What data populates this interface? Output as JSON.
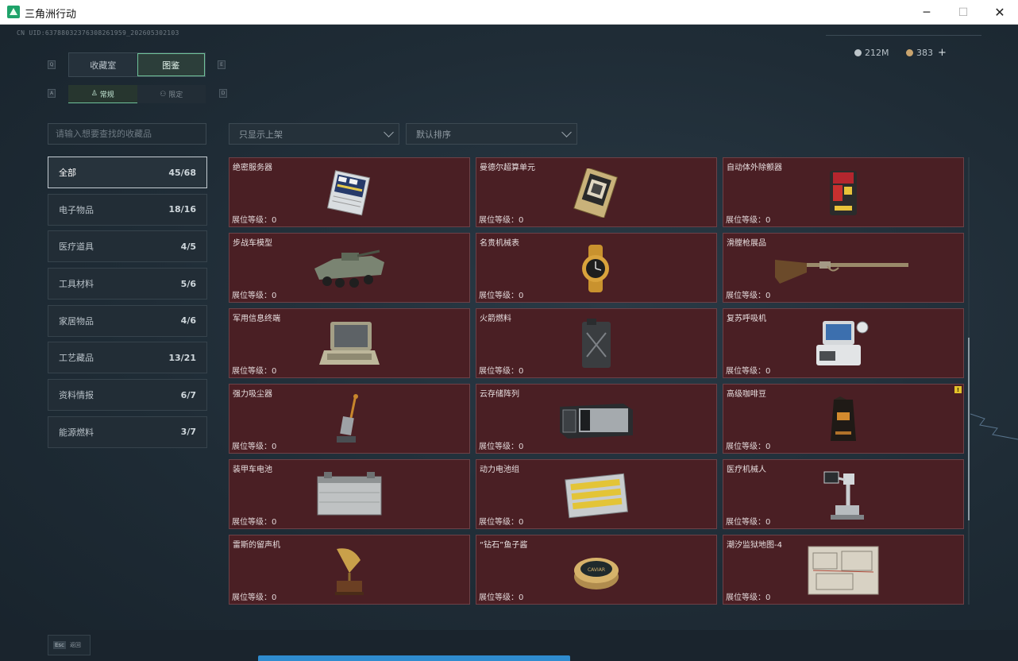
{
  "window": {
    "title": "三角洲行动",
    "min_glyph": "─",
    "max_glyph": "☐",
    "close_glyph": "✕"
  },
  "header": {
    "uid": "CN UID:6378803237630826195​9_202605302103",
    "currency_1": "212M",
    "currency_2": "383",
    "add_glyph": "+"
  },
  "hints": {
    "q": "Q",
    "e": "E",
    "a": "A",
    "d": "D"
  },
  "tabs": [
    {
      "label": "收藏室"
    },
    {
      "label": "图鉴"
    }
  ],
  "subtabs": [
    {
      "label": "常规",
      "icon": "♙"
    },
    {
      "label": "限定",
      "icon": "⚇"
    }
  ],
  "search": {
    "placeholder": "请输入想要查找的收藏品"
  },
  "filters": {
    "shelf": "只显示上架",
    "sort": "默认排序"
  },
  "categories": [
    {
      "label": "全部",
      "count": "45/68"
    },
    {
      "label": "电子物品",
      "count": "18/16"
    },
    {
      "label": "医疗道具",
      "count": "4/5"
    },
    {
      "label": "工具材料",
      "count": "5/6"
    },
    {
      "label": "家居物品",
      "count": "4/6"
    },
    {
      "label": "工艺藏品",
      "count": "13/21"
    },
    {
      "label": "资料情报",
      "count": "6/7"
    },
    {
      "label": "能源燃料",
      "count": "3/7"
    }
  ],
  "items": [
    {
      "name": "绝密服务器",
      "level": "展位等级：0",
      "icon": "server-icon"
    },
    {
      "name": "曼德尔超算单元",
      "level": "展位等级：0",
      "icon": "computing-unit-icon"
    },
    {
      "name": "自动体外除颤器",
      "level": "展位等级：0",
      "icon": "defibrillator-icon"
    },
    {
      "name": "步战车模型",
      "level": "展位等级：0",
      "icon": "armored-vehicle-icon"
    },
    {
      "name": "名贵机械表",
      "level": "展位等级：0",
      "icon": "watch-icon"
    },
    {
      "name": "滑膛枪展品",
      "level": "展位等级：0",
      "icon": "musket-icon"
    },
    {
      "name": "军用信息终端",
      "level": "展位等级：0",
      "icon": "terminal-icon"
    },
    {
      "name": "火箭燃料",
      "level": "展位等级：0",
      "icon": "fuel-can-icon"
    },
    {
      "name": "复苏呼吸机",
      "level": "展位等级：0",
      "icon": "ventilator-icon"
    },
    {
      "name": "强力吸尘器",
      "level": "展位等级：0",
      "icon": "vacuum-icon"
    },
    {
      "name": "云存储阵列",
      "level": "展位等级：0",
      "icon": "storage-array-icon"
    },
    {
      "name": "高级咖啡豆",
      "level": "展位等级：0",
      "icon": "coffee-bag-icon",
      "warning": "!"
    },
    {
      "name": "装甲车电池",
      "level": "展位等级：0",
      "icon": "battery-icon"
    },
    {
      "name": "动力电池组",
      "level": "展位等级：0",
      "icon": "battery-pack-icon"
    },
    {
      "name": "医疗机械人",
      "level": "展位等级：0",
      "icon": "medical-robot-icon"
    },
    {
      "name": "雷斯的留声机",
      "level": "展位等级：0",
      "icon": "gramophone-icon"
    },
    {
      "name": "“钻石”鱼子酱",
      "level": "展位等级：0",
      "icon": "caviar-tin-icon",
      "tin_label": "CAVIAR"
    },
    {
      "name": "潮汐监狱地图-4",
      "level": "展位等级：0",
      "icon": "map-icon"
    }
  ],
  "footer": {
    "esc_key": "Esc",
    "back_label": "返回"
  },
  "colors": {
    "accent": "#6fc29a",
    "card_bg": "#4a1f24",
    "bar": "#2f8ccf"
  }
}
